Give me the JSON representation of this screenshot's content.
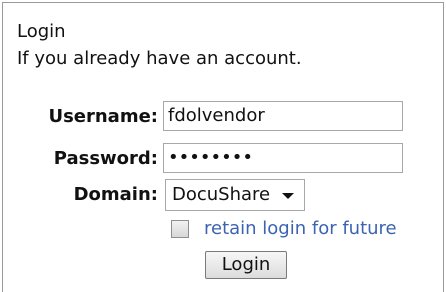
{
  "login_panel": {
    "title": "Login",
    "subtitle": "If you already have an account.",
    "username_label": "Username:",
    "username_value": "fdolvendor",
    "password_label": "Password:",
    "password_mask": "••••••••",
    "domain_label": "Domain:",
    "domain_selected": "DocuShare",
    "retain_label": "retain login for future",
    "retain_checked": false,
    "login_button": "Login"
  },
  "colors": {
    "link_blue": "#3c63b3",
    "border_gray": "#a8a8a8"
  }
}
